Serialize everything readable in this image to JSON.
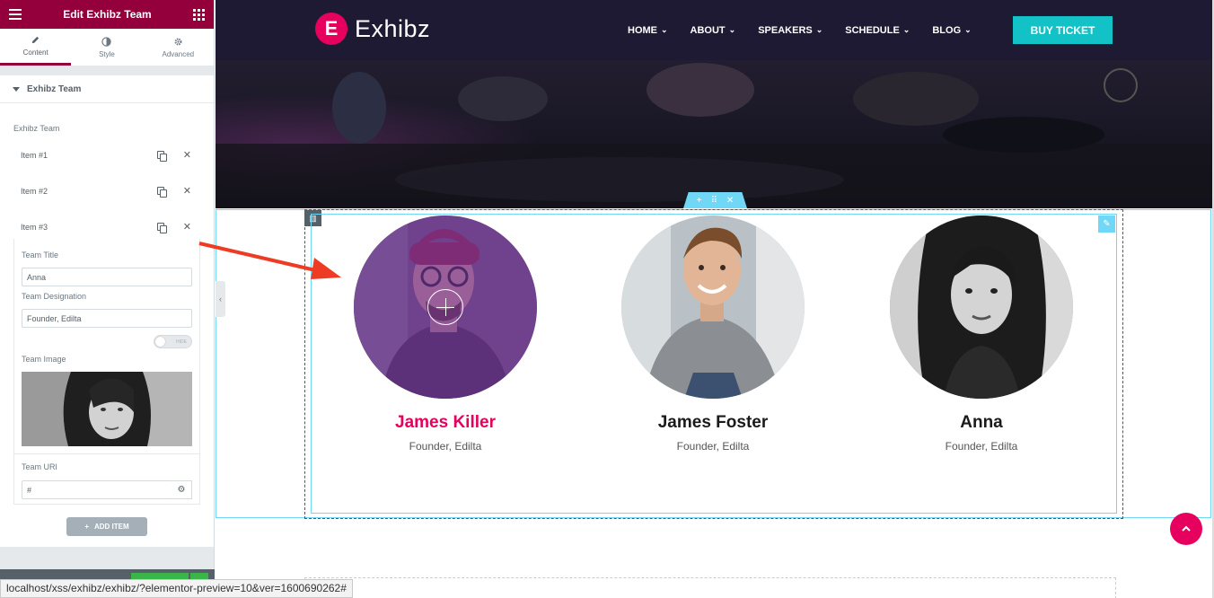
{
  "editor": {
    "title": "Edit Exhibz Team",
    "tabs": [
      {
        "label": "Content",
        "icon": "pencil-icon"
      },
      {
        "label": "Style",
        "icon": "contrast-icon"
      },
      {
        "label": "Advanced",
        "icon": "gear-icon"
      }
    ],
    "section_title": "Exhibz Team",
    "control_label": "Exhibz Team",
    "items": [
      "Item #1",
      "Item #2",
      "Item #3"
    ],
    "fields": {
      "team_title_label": "Team Title",
      "team_title_value": "Anna",
      "team_designation_label": "Team Designation",
      "team_designation_value": "Founder, Edilta",
      "toggle_label": "HIDE",
      "team_image_label": "Team Image",
      "team_url_label": "Team URl",
      "team_url_value": "#"
    },
    "add_item_label": "ADD ITEM"
  },
  "status_url": "localhost/xss/exhibz/exhibz/?elementor-preview=10&ver=1600690262#",
  "site": {
    "logo_letter": "E",
    "logo_text": "Exhibz",
    "nav": [
      "HOME",
      "ABOUT",
      "SPEAKERS",
      "SCHEDULE",
      "BLOG"
    ],
    "buy_ticket": "BUY TICKET"
  },
  "team": [
    {
      "name": "James Killer",
      "role": "Founder, Edilta",
      "highlight": true
    },
    {
      "name": "James Foster",
      "role": "Founder, Edilta",
      "highlight": false
    },
    {
      "name": "Anna",
      "role": "Founder, Edilta",
      "highlight": false
    }
  ],
  "colors": {
    "editor_brand": "#93003c",
    "site_accent": "#e7015e",
    "ticket_button": "#12c2c6",
    "edit_outline": "#71d7f7",
    "annotation_arrow": "#ee3b24"
  }
}
